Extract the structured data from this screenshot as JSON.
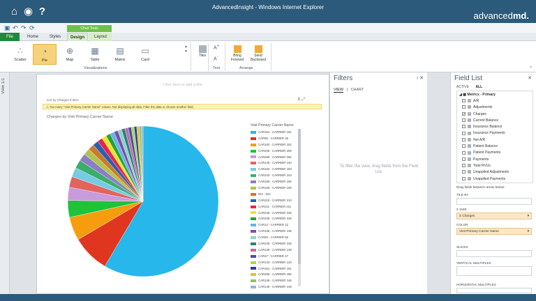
{
  "window": {
    "title": "AdvancedInsight - Windows Internet Explorer"
  },
  "brand": {
    "prefix": "advanced",
    "suffix": "md."
  },
  "ribbon": {
    "context_tab": "Chart Tools",
    "tabs": [
      "File",
      "Home",
      "Styles",
      "Design",
      "Layout"
    ],
    "active_tab": "Design",
    "visualizations": [
      "Scatter",
      "Pie",
      "Map",
      "Table",
      "Matrix",
      "Card"
    ],
    "selected_visualization": "Pie",
    "visualizations_label": "Visualizations",
    "tiles_label": "Tiles",
    "text_label": "Text",
    "arrange_label": "Arrange",
    "bring_forward": "Bring Forward",
    "send_backward": "Send Backward"
  },
  "view_strip": {
    "label": "View 1/1"
  },
  "canvas": {
    "click_title": "Click here to add a title",
    "sort_text": "sort by  Charges  ▾  desc",
    "warning": "Too many \"Visit Primary Carrier Name\" values. Not displaying all data. Filter the data or choose another field."
  },
  "chart_data": {
    "type": "pie",
    "title": "Charges by Visit Primary Carrier Name",
    "legend_title": "Visit Primary Carrier Name",
    "legend_placement": "right",
    "categories": [
      "CAR161 - CARRIER 161",
      "CAR55 - CARRIER 35",
      "CAR162 - CARRIER 162",
      "CAR205 - CARRIER 205",
      "CAR269 - CARRIER 266",
      "CAR140 - CARRIER 140",
      "CAR153 - CARRIER 153",
      "CAR243 - CARRIER 243",
      "CAR165 - CARRIER 165",
      "CAR106 - CARRIER 106",
      "N/A - N/A",
      "CAR210 - CARRIER 210",
      "CAR211 - CARRIER 211",
      "CAR246 - CARRIER 246",
      "CAR249 - CARRIER 249",
      "CAR12 - CARRIER 12",
      "CAR136 - CARRIER 136",
      "CAR50 - CARRIER 50",
      "CAR245 - CARRIER 245",
      "CAR139 - CARRIER 139",
      "CAR47 - CARRIER 47",
      "CAR143 - CARRIER 143",
      "CAR151 - CARRIER 151",
      "CAR255 - CARRIER 255",
      "CAR146 - CARRIER 146",
      "CAR149 - CARRIER 149"
    ],
    "values": [
      58.0,
      8.0,
      5.0,
      3.6,
      2.8,
      2.3,
      2.0,
      1.8,
      1.6,
      1.4,
      1.3,
      1.2,
      1.1,
      1.0,
      0.95,
      0.9,
      0.85,
      0.8,
      0.75,
      0.7,
      0.65,
      0.6,
      0.55,
      0.5,
      0.45,
      0.4
    ],
    "colors": [
      "#27b7ea",
      "#e0351f",
      "#f59d0d",
      "#1ec33a",
      "#c89bdc",
      "#e1645f",
      "#76cbe2",
      "#3cae6b",
      "#8c7dc9",
      "#b1c44f",
      "#cc7a2a",
      "#2a5fb0",
      "#e6254d",
      "#f2e22b",
      "#27a335",
      "#61b5ea",
      "#7b4fa8",
      "#8bd4c5",
      "#2f7d8c",
      "#bf6f9a",
      "#4f4ba8",
      "#a3d85b",
      "#2b3f9c",
      "#e2c232",
      "#8cc36e",
      "#9fb3c9"
    ]
  },
  "filters": {
    "title": "Filters",
    "tabs": [
      "VIEW",
      "CHART"
    ],
    "hint": "To filter the view, drag fields from the Field List."
  },
  "field_list": {
    "title": "Field List",
    "tabs": [
      "ACTIVE",
      "ALL"
    ],
    "group": "Metrics - Primary",
    "fields": [
      {
        "name": "A/R",
        "checked": false
      },
      {
        "name": "Adjustments",
        "checked": false
      },
      {
        "name": "Charges",
        "checked": true
      },
      {
        "name": "Current Balance",
        "checked": false
      },
      {
        "name": "Insurance Balance",
        "checked": false
      },
      {
        "name": "Insurance Payments",
        "checked": false
      },
      {
        "name": "Net A/R",
        "checked": false
      },
      {
        "name": "Patient Balance",
        "checked": false
      },
      {
        "name": "Patient Payments",
        "checked": false
      },
      {
        "name": "Payments",
        "checked": false
      },
      {
        "name": "Total RVUs",
        "checked": false
      },
      {
        "name": "Unapplied Adjustments",
        "checked": false
      },
      {
        "name": "Unapplied Payments",
        "checked": false
      }
    ],
    "zones_hint": "Drag fields between areas below:",
    "zones": {
      "tile_by": "TILE BY",
      "size": "Σ SIZE",
      "size_value": "Σ Charges",
      "color": "COLOR",
      "color_value": "Visit Primary Carrier Name",
      "slices": "SLICES",
      "vertical_multiples": "VERTICAL MULTIPLES",
      "horizontal_multiples": "HORIZONTAL MULTIPLES"
    }
  }
}
